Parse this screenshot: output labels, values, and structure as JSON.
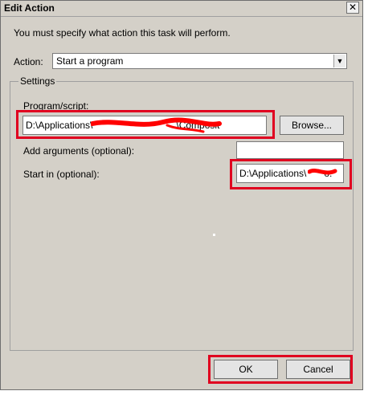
{
  "window": {
    "title": "Edit Action",
    "close_glyph": "✕"
  },
  "instruction": "You must specify what action this task will perform.",
  "action": {
    "label": "Action:",
    "value": "Start a program"
  },
  "settings": {
    "group_title": "Settings",
    "program": {
      "label": "Program/script:",
      "value": "D:\\Applications\\",
      "value_suffix": "\\Composit"
    },
    "browse_label": "Browse...",
    "arguments": {
      "label": "Add arguments (optional):",
      "value": ""
    },
    "start_in": {
      "label": "Start in (optional):",
      "value": "D:\\Applications\\",
      "value_suffix": "o:"
    }
  },
  "buttons": {
    "ok": "OK",
    "cancel": "Cancel"
  },
  "colors": {
    "highlight": "#e0001f",
    "redaction": "#ff0000"
  }
}
